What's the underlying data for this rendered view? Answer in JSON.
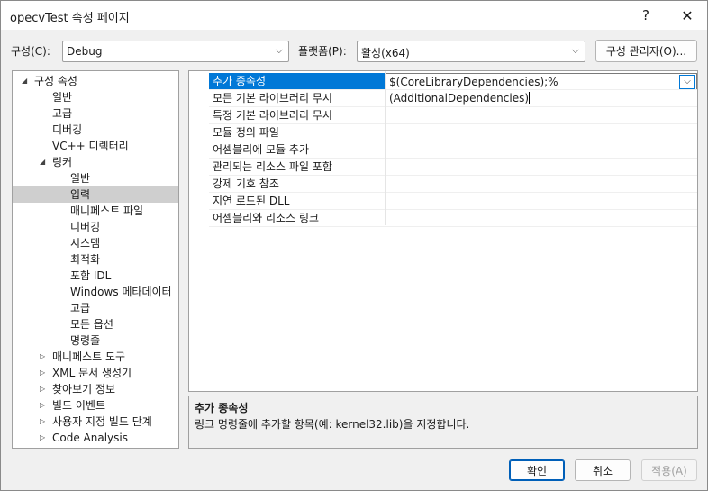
{
  "window": {
    "title": "opecvTest 속성 페이지",
    "help": "?",
    "close": "✕"
  },
  "toolbar": {
    "config_label": "구성(C):",
    "config_value": "Debug",
    "platform_label": "플랫폼(P):",
    "platform_value": "활성(x64)",
    "manager_button": "구성 관리자(O)..."
  },
  "tree": [
    {
      "label": "구성 속성",
      "level": 0,
      "expander": "open"
    },
    {
      "label": "일반",
      "level": 1
    },
    {
      "label": "고급",
      "level": 1
    },
    {
      "label": "디버깅",
      "level": 1
    },
    {
      "label": "VC++ 디렉터리",
      "level": 1
    },
    {
      "label": "링커",
      "level": 1,
      "expander": "open"
    },
    {
      "label": "일반",
      "level": 2
    },
    {
      "label": "입력",
      "level": 2,
      "selected": true
    },
    {
      "label": "매니페스트 파일",
      "level": 2
    },
    {
      "label": "디버깅",
      "level": 2
    },
    {
      "label": "시스템",
      "level": 2
    },
    {
      "label": "최적화",
      "level": 2
    },
    {
      "label": "포함 IDL",
      "level": 2
    },
    {
      "label": "Windows 메타데이터",
      "level": 2
    },
    {
      "label": "고급",
      "level": 2
    },
    {
      "label": "모든 옵션",
      "level": 2
    },
    {
      "label": "명령줄",
      "level": 2
    },
    {
      "label": "매니페스트 도구",
      "level": 1,
      "expander": "closed"
    },
    {
      "label": "XML 문서 생성기",
      "level": 1,
      "expander": "closed"
    },
    {
      "label": "찾아보기 정보",
      "level": 1,
      "expander": "closed"
    },
    {
      "label": "빌드 이벤트",
      "level": 1,
      "expander": "closed"
    },
    {
      "label": "사용자 지정 빌드 단계",
      "level": 1,
      "expander": "closed"
    },
    {
      "label": "Code Analysis",
      "level": 1,
      "expander": "closed"
    }
  ],
  "grid": [
    {
      "name": "추가 종속성",
      "value": "$(CoreLibraryDependencies);%(AdditionalDependencies)",
      "selected": true
    },
    {
      "name": "모든 기본 라이브러리 무시",
      "value": ""
    },
    {
      "name": "특정 기본 라이브러리 무시",
      "value": ""
    },
    {
      "name": "모듈 정의 파일",
      "value": ""
    },
    {
      "name": "어셈블리에 모듈 추가",
      "value": ""
    },
    {
      "name": "관리되는 리소스 파일 포함",
      "value": ""
    },
    {
      "name": "강제 기호 참조",
      "value": ""
    },
    {
      "name": "지연 로드된 DLL",
      "value": ""
    },
    {
      "name": "어셈블리와 리소스 링크",
      "value": ""
    }
  ],
  "description": {
    "title": "추가 종속성",
    "text": "링크 명령줄에 추가할 항목(예: kernel32.lib)을 지정합니다."
  },
  "footer": {
    "ok": "확인",
    "cancel": "취소",
    "apply": "적용(A)"
  },
  "icons": {
    "chevron": "⌵",
    "expanded": "◢",
    "collapsed": "▷"
  }
}
